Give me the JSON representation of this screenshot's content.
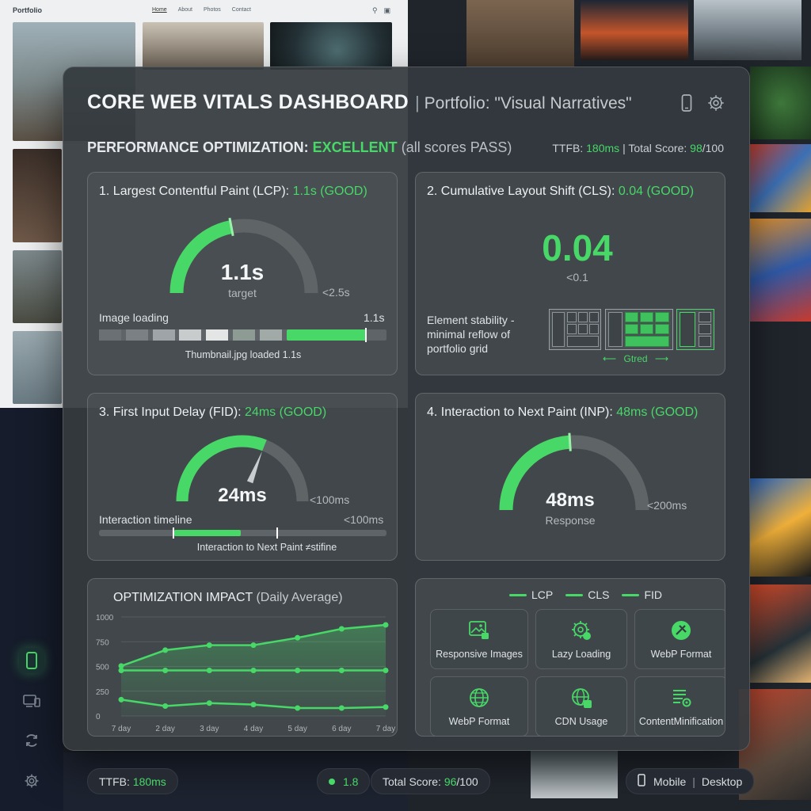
{
  "background": {
    "brand": "Portfolio",
    "nav": [
      "Home",
      "About",
      "Photos",
      "Contact"
    ]
  },
  "header": {
    "title": "CORE WEB VITALS DASHBOARD",
    "separator": "|",
    "subtitle": "Portfolio: \"Visual Narratives\""
  },
  "summary": {
    "label": "PERFORMANCE OPTIMIZATION:",
    "status": "EXCELLENT",
    "note": "(all scores PASS)",
    "ttfb_label": "TTFB:",
    "ttfb_value": "180ms",
    "sep": "|",
    "score_label": "Total Score:",
    "score_value": "98",
    "score_max": "/100"
  },
  "lcp": {
    "title": "1. Largest Contentful Paint (LCP):",
    "value_label": "1.1s (GOOD)",
    "value": "1.1s",
    "caption": "target",
    "threshold": "<2.5s",
    "fraction": 0.44,
    "strip_label": "Image loading",
    "strip_time": "1.1s",
    "strip_caption": "Thumbnail.jpg loaded 1.1s"
  },
  "cls": {
    "title": "2. Cumulative Layout Shift (CLS):",
    "value_label": "0.04 (GOOD)",
    "value": "0.04",
    "threshold": "<0.1",
    "desc": "Element stability - minimal reflow of portfolio grid",
    "arrow_label": "Gtred"
  },
  "fid": {
    "title": "3. First Input Delay (FID):",
    "value_label": "24ms (GOOD)",
    "value": "24ms",
    "threshold": "<100ms",
    "fraction": 0.62,
    "timeline_label": "Interaction timeline",
    "timeline_threshold": "<100ms",
    "timeline_caption": "Interaction to Next Paint ≠stifine"
  },
  "inp": {
    "title": "4. Interaction to Next Paint (INP):",
    "value_label": "48ms (GOOD)",
    "value": "48ms",
    "caption": "Response",
    "threshold": "<200ms",
    "fraction": 0.48
  },
  "impact": {
    "title": "OPTIMIZATION IMPACT",
    "title_note": "(Daily Average)"
  },
  "legend": [
    "LCP",
    "CLS",
    "FID"
  ],
  "optimizations": [
    {
      "label": "Responsive Images",
      "icon": "image-lock-icon"
    },
    {
      "label": "Lazy Loading",
      "icon": "gear-clock-icon"
    },
    {
      "label": "WebP Format",
      "icon": "webp-badge-icon"
    },
    {
      "label": "WebP Format",
      "icon": "globe-icon"
    },
    {
      "label": "CDN Usage",
      "icon": "globe-check-icon"
    },
    {
      "label": "ContentMinification",
      "icon": "list-gear-icon"
    }
  ],
  "footer": {
    "ttfb_label": "TTFB:",
    "ttfb_value": "180ms",
    "indicator": "1.8",
    "score_label": "Total Score:",
    "score_value": "96",
    "score_max": "/100",
    "mode_mobile": "Mobile",
    "mode_sep": "|",
    "mode_desktop": "Desktop"
  },
  "colors": {
    "accent": "#47d868",
    "track": "#5f6467",
    "panel": "#343a3e"
  },
  "chart_data": {
    "type": "line",
    "title": "OPTIMIZATION IMPACT (Daily Average)",
    "categories": [
      "7 day",
      "2 day",
      "3 day",
      "4 day",
      "5 day",
      "6 day",
      "7 day"
    ],
    "yticks": [
      0,
      250,
      500,
      750,
      1000
    ],
    "ylim": [
      0,
      1000
    ],
    "series": [
      {
        "values": [
          505,
          665,
          715,
          715,
          790,
          880,
          920
        ]
      },
      {
        "values": [
          460,
          460,
          460,
          460,
          460,
          460,
          460
        ]
      },
      {
        "values": [
          165,
          100,
          130,
          115,
          80,
          80,
          90
        ]
      }
    ],
    "legend_position": "top",
    "grid": true
  }
}
